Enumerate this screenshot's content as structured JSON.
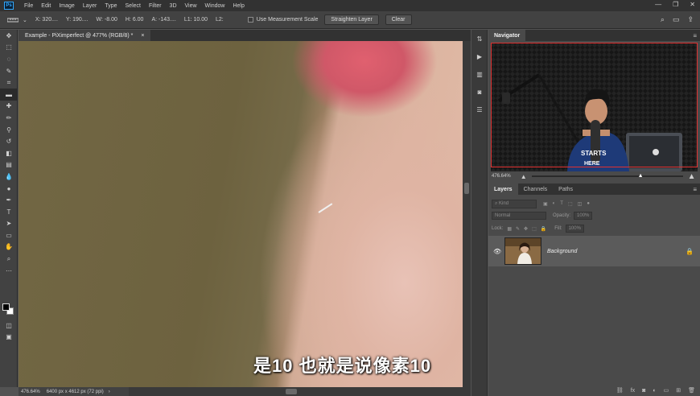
{
  "menubar": {
    "app_icon": "Ps",
    "items": [
      "File",
      "Edit",
      "Image",
      "Layer",
      "Type",
      "Select",
      "Filter",
      "3D",
      "View",
      "Window",
      "Help"
    ]
  },
  "options": {
    "x": "X: 320....",
    "y": "Y: 190....",
    "w": "W: -8.00",
    "h": "H: 6.00",
    "angle": "A: -143....",
    "l1": "L1: 10.00",
    "l2": "L2:",
    "use_scale_label": "Use Measurement Scale",
    "straighten_label": "Straighten Layer",
    "clear_label": "Clear"
  },
  "document": {
    "tab_title": "Example - PiXimperfect @ 477% (RGB/8) *",
    "close": "×",
    "subtitle": "是10 也就是说像素10"
  },
  "status": {
    "zoom": "476.64%",
    "size": "6400 px x 4612 px (72 ppi)"
  },
  "navigator": {
    "tab": "Navigator",
    "zoom": "476.64%"
  },
  "layers": {
    "tabs": [
      "Layers",
      "Channels",
      "Paths"
    ],
    "kind": "Kind",
    "blend": "Normal",
    "opacity_label": "Opacity:",
    "opacity_value": "100%",
    "lock_label": "Lock:",
    "fill_label": "Fill:",
    "fill_value": "100%",
    "layer_name": "Background"
  },
  "colors": {
    "accent": "#31a8ff",
    "panel_bg": "#4a4a4a",
    "nav_frame": "#e03030"
  }
}
